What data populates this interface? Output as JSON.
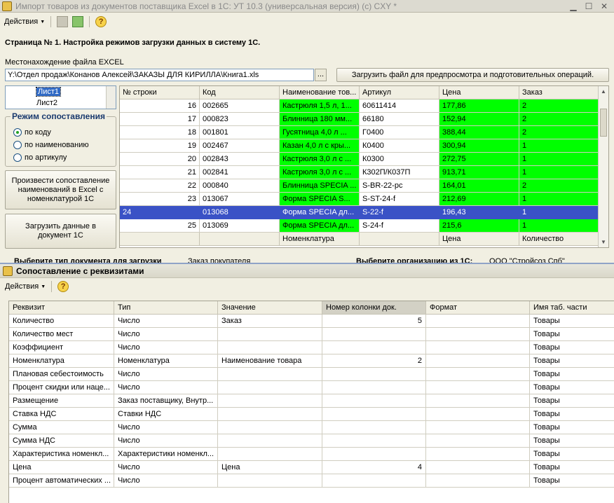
{
  "window": {
    "title": "Импорт товаров из документов поставщика Excel в 1С: УТ 10.3 (универсальная версия) (c) CXY *"
  },
  "toolbar": {
    "actions_label": "Действия",
    "help": "?"
  },
  "page": {
    "header": "Страница № 1. Настройка режимов загрузки данных в систему 1С.",
    "file_label": "Местонахождение файла EXCEL",
    "file_path": "Y:\\Отдел продаж\\Конанов Алексей\\ЗАКАЗЫ ДЛЯ КИРИЛЛА\\Книга1.xls",
    "dots": "...",
    "load_preview_button": "Загрузить файл для предпросмотра и подготовительных операций."
  },
  "sheets": [
    "Лист1",
    "Лист2"
  ],
  "mode": {
    "legend": "Режим сопоставления",
    "options": [
      "по коду",
      "по наименованию",
      "по артикулу"
    ],
    "selected": 0
  },
  "buttons": {
    "match": "Произвести сопоставление наименований в Excel с номенклатурой 1С",
    "load": "Загрузить данные в документ 1С"
  },
  "grid": {
    "headers": [
      "№ строки",
      "Код",
      "Наименование тов...",
      "Артикул",
      "Цена",
      "Заказ"
    ],
    "rows": [
      [
        "16",
        "002665",
        "Кастрюля 1,5 л, 1...",
        "60611414",
        "177,86",
        "2"
      ],
      [
        "17",
        "000823",
        "Блинница 180 мм...",
        "66180",
        "152,94",
        "2"
      ],
      [
        "18",
        "001801",
        "Гусятница 4,0 л ...",
        "Г0400",
        "388,44",
        "2"
      ],
      [
        "19",
        "002467",
        "Казан 4,0 л с кры...",
        "К0400",
        "300,94",
        "1"
      ],
      [
        "20",
        "002843",
        "Кастрюля 3,0 л с ...",
        "К0300",
        "272,75",
        "1"
      ],
      [
        "21",
        "002841",
        "Кастрюля 3,0 л с ...",
        "К302П/К037П",
        "913,71",
        "1"
      ],
      [
        "22",
        "000840",
        "Блинница SPECIA ...",
        "S-BR-22-pc",
        "164,01",
        "2"
      ],
      [
        "23",
        "013067",
        "Форма SPECIA S...",
        "S-ST-24-f",
        "212,69",
        "1"
      ],
      [
        "24",
        "013068",
        "Форма SPECIA дл...",
        "S-22-f",
        "196,43",
        "1"
      ],
      [
        "25",
        "013069",
        "Форма SPECIA дл...",
        "S-24-f",
        "215,6",
        "1"
      ]
    ],
    "selected_row": 8,
    "footer": [
      "",
      "",
      "Номенклатура",
      "",
      "Цена",
      "Количество"
    ]
  },
  "hidden_labels": {
    "left": "Выберите тип документа для загрузки",
    "left_value": "Заказ покупателя",
    "right": "Выберите организацию из 1С:",
    "right_value": "ООО \"Стройсоз Спб\""
  },
  "sub": {
    "title": "Сопоставление с реквизитами",
    "actions_label": "Действия",
    "help": "?",
    "headers": [
      "Реквизит",
      "Тип",
      "Значение",
      "Номер колонки док.",
      "Формат",
      "Имя таб. части"
    ],
    "rows": [
      [
        "Количество",
        "Число",
        "Заказ",
        "5",
        "",
        "Товары"
      ],
      [
        "Количество мест",
        "Число",
        "",
        "",
        "",
        "Товары"
      ],
      [
        "Коэффициент",
        "Число",
        "",
        "",
        "",
        "Товары"
      ],
      [
        "Номенклатура",
        "Номенклатура",
        "Наименование товара",
        "2",
        "",
        "Товары"
      ],
      [
        "Плановая себестоимость",
        "Число",
        "",
        "",
        "",
        "Товары"
      ],
      [
        "Процент скидки или наце...",
        "Число",
        "",
        "",
        "",
        "Товары"
      ],
      [
        "Размещение",
        "Заказ поставщику, Внутр...",
        "",
        "",
        "",
        "Товары"
      ],
      [
        "Ставка НДС",
        "Ставки НДС",
        "",
        "",
        "",
        "Товары"
      ],
      [
        "Сумма",
        "Число",
        "",
        "",
        "",
        "Товары"
      ],
      [
        "Сумма НДС",
        "Число",
        "",
        "",
        "",
        "Товары"
      ],
      [
        "Характеристика номенкл...",
        "Характеристики номенкл...",
        "",
        "",
        "",
        "Товары"
      ],
      [
        "Цена",
        "Число",
        "Цена",
        "4",
        "",
        "Товары"
      ],
      [
        "Процент автоматических ...",
        "Число",
        "",
        "",
        "",
        "Товары"
      ]
    ]
  },
  "colors": {
    "match": "#00ff00",
    "selected": "#3a52c6"
  }
}
